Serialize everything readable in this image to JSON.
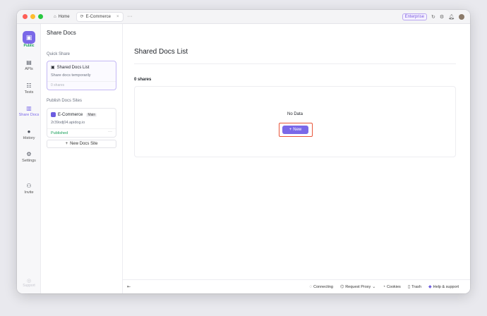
{
  "titlebar": {
    "tabs": [
      {
        "label": "Home",
        "icon": "home-icon"
      },
      {
        "label": "E-Commerce",
        "icon": "project-icon"
      }
    ],
    "enterprise_label": "Enterprise"
  },
  "rail": {
    "project_badge": "Public",
    "items": [
      {
        "label": "APIs",
        "icon": "apis-icon"
      },
      {
        "label": "Tests",
        "icon": "tests-icon"
      },
      {
        "label": "Share Docs",
        "icon": "share-docs-icon"
      },
      {
        "label": "History",
        "icon": "history-icon"
      },
      {
        "label": "Settings",
        "icon": "settings-icon"
      },
      {
        "label": "Invite",
        "icon": "invite-icon"
      }
    ],
    "bottom_label": "Support"
  },
  "panel": {
    "title": "Share Docs",
    "quick_share_label": "Quick Share",
    "quick_share_card": {
      "title": "Shared Docs List",
      "desc": "Share docs temporarily",
      "foot": "0 shares"
    },
    "publish_label": "Publish Docs Sites",
    "site_card": {
      "name": "E-Commerce",
      "tag": "Main",
      "url": "2r39odj04.apidog.io",
      "status": "Published",
      "more": "···"
    },
    "new_site_label": "New Docs Site"
  },
  "main": {
    "title": "Shared Docs List",
    "shares_count": "0 shares",
    "empty_text": "No Data",
    "new_button_label": "New"
  },
  "statusbar": {
    "connecting": "Connecting",
    "request_proxy": "Request Proxy",
    "cookies": "Cookies",
    "trash": "Trash",
    "help": "Help & support"
  },
  "colors": {
    "accent": "#7a68e8",
    "published": "#19a05a",
    "highlight": "#e8553a"
  }
}
